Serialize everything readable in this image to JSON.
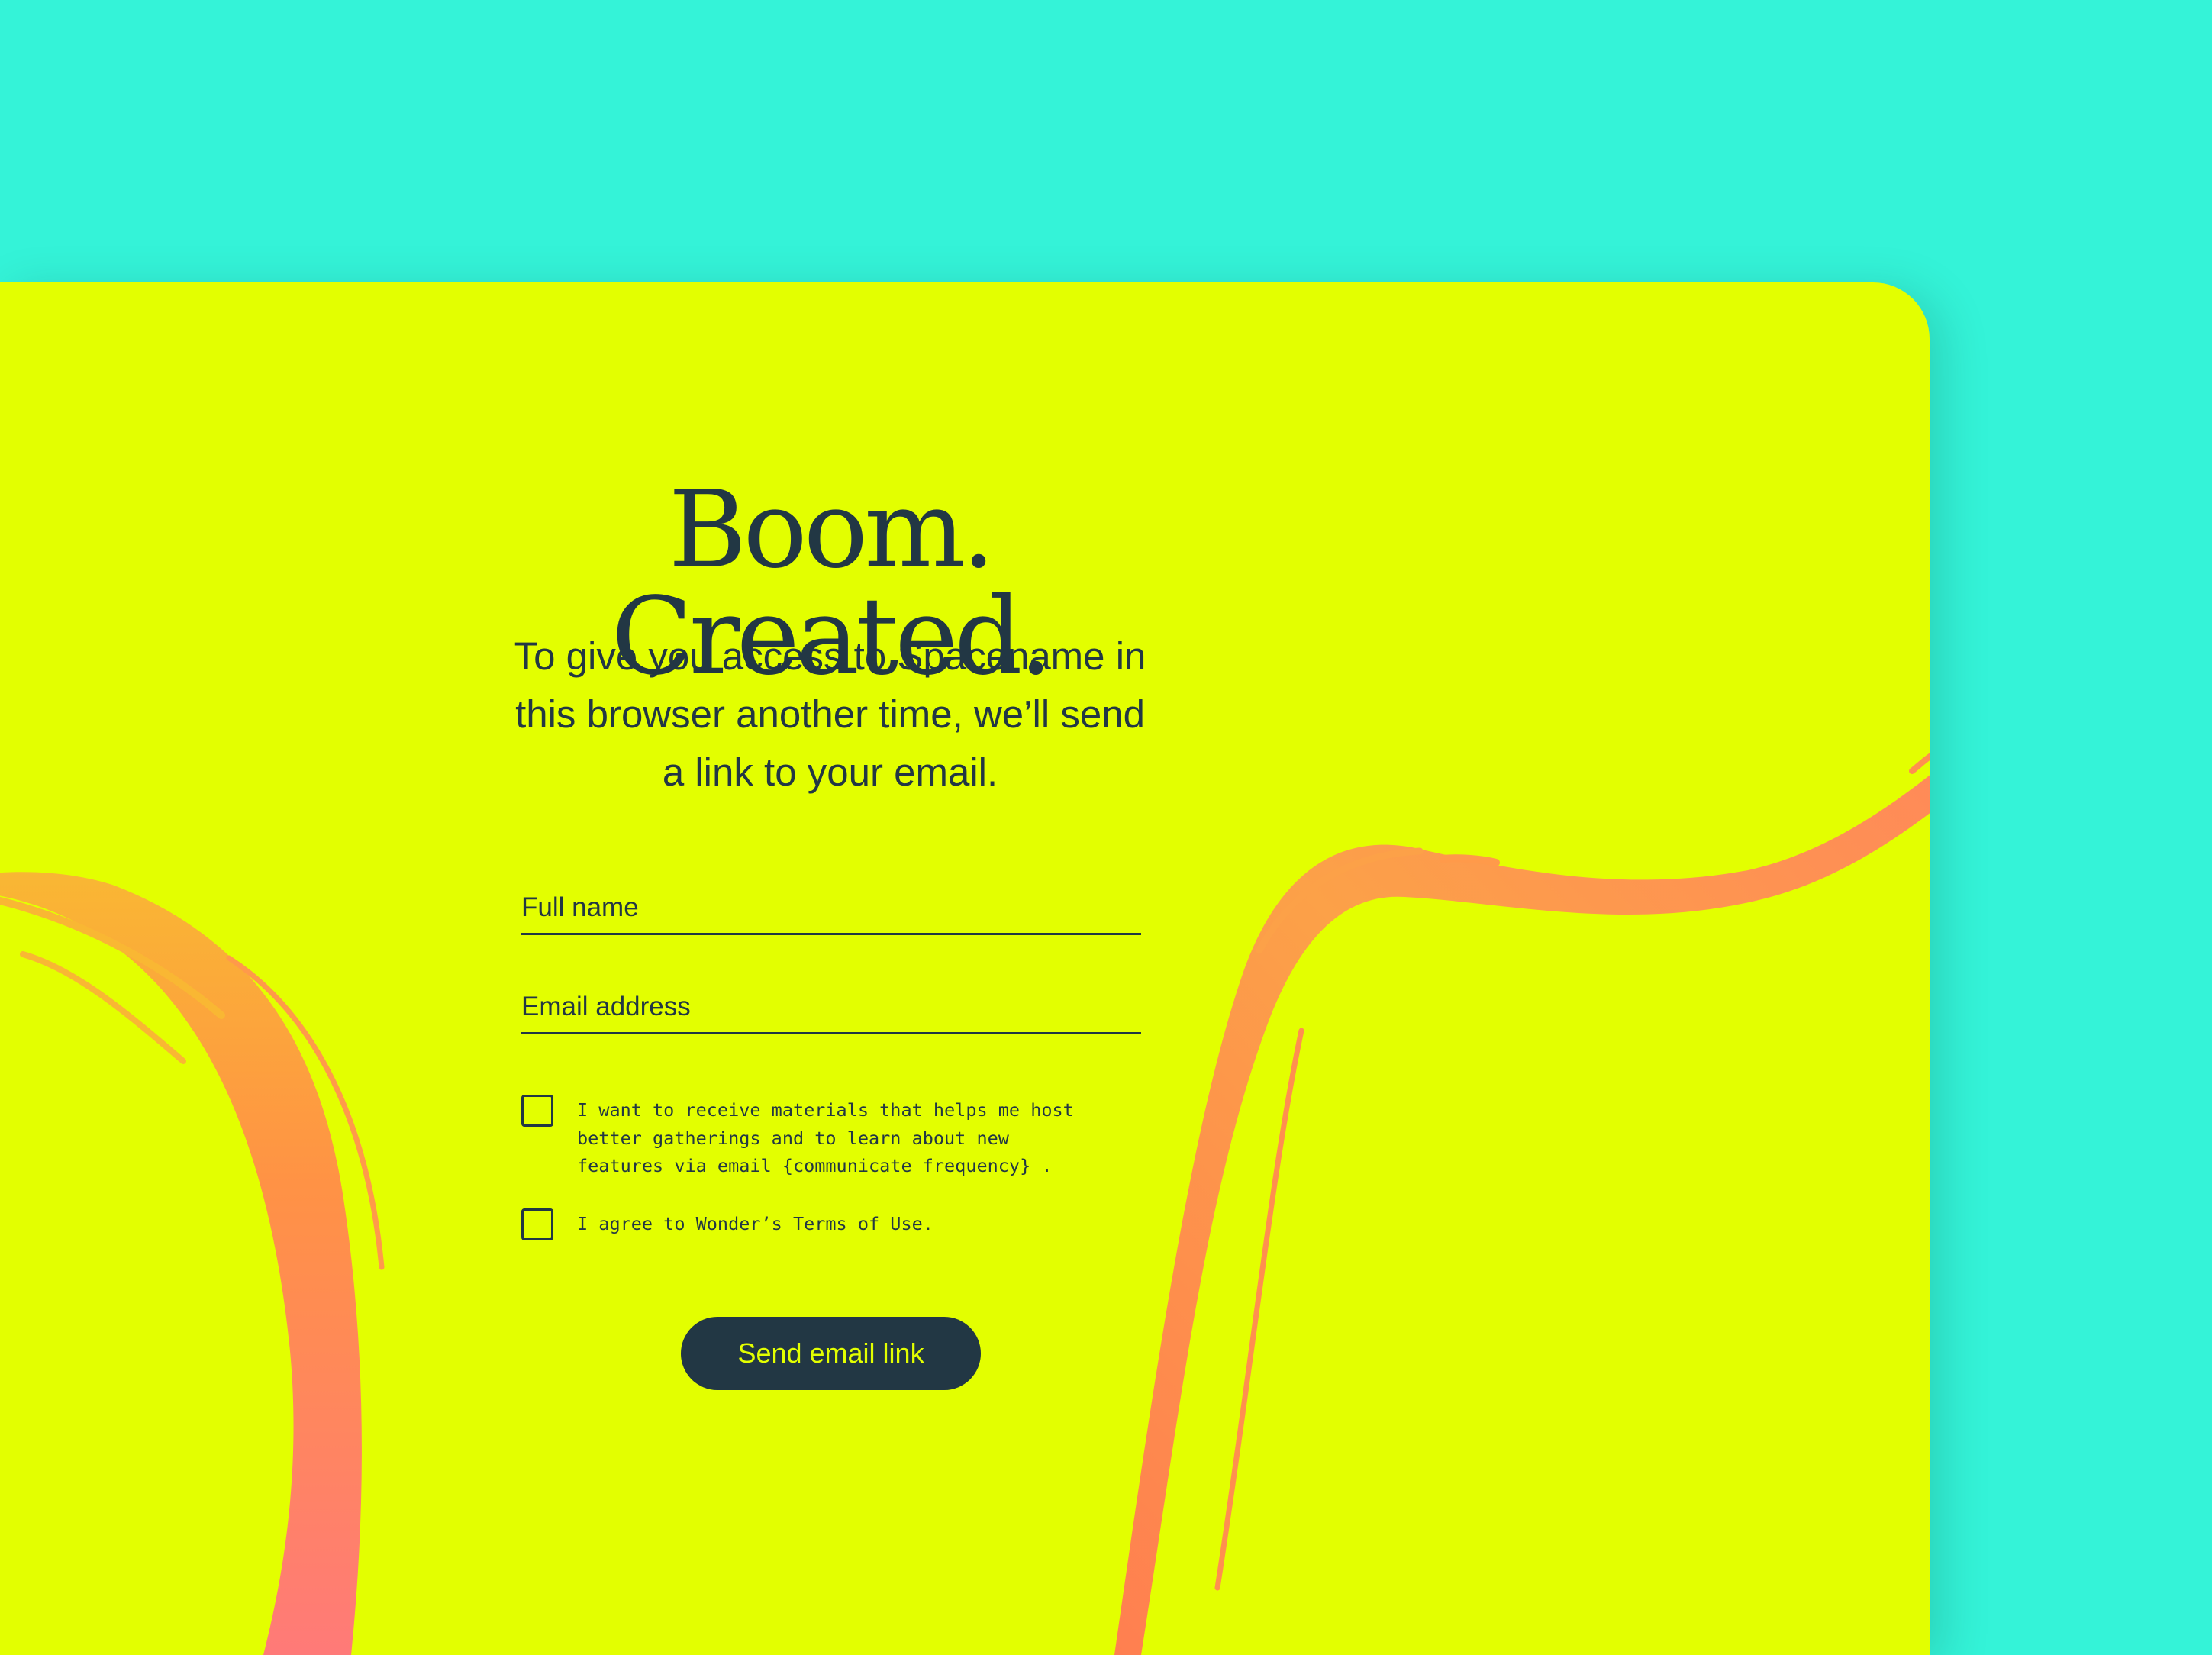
{
  "page": {
    "headline": "Boom. Created.",
    "subtitle": "To give you access to Spacename in this browser another time, we’ll send a link to your email."
  },
  "form": {
    "full_name": {
      "placeholder": "Full name",
      "value": ""
    },
    "email": {
      "placeholder": "Email address",
      "value": ""
    },
    "marketing_consent": {
      "label": "I want to receive materials that helps me host better gatherings and to learn about new features via email {communicate frequency} .",
      "checked": false
    },
    "terms_consent": {
      "label": "I agree to Wonder’s Terms of Use.",
      "checked": false
    },
    "submit_label": "Send email link"
  },
  "colors": {
    "background": "#34f3d8",
    "card": "#e3ff00",
    "ink": "#223744",
    "brush_stroke": "#ff8f4f",
    "button_text": "#e3ff00"
  },
  "decorations": {
    "left_stroke": "brush-stroke",
    "right_stroke": "brush-stroke"
  }
}
